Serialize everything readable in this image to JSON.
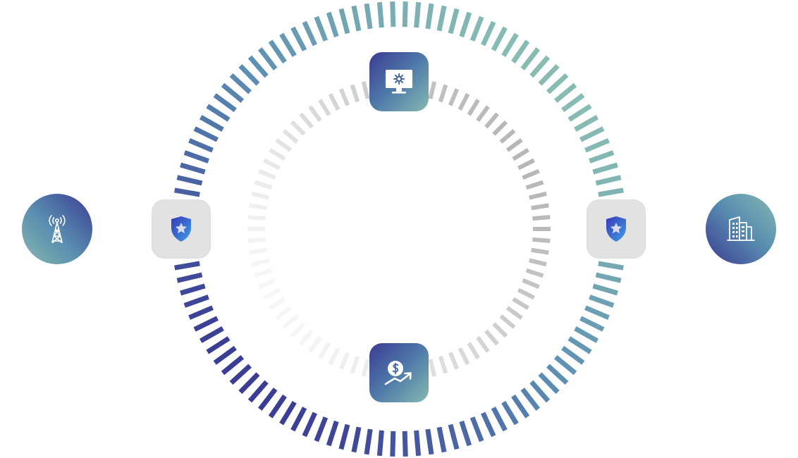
{
  "diagram": {
    "outer_ring": {
      "gradient": [
        "#88bcb3",
        "#5b8db3",
        "#3a3d93"
      ]
    },
    "inner_ring": {
      "gradient": [
        "#f6f6f6",
        "#b4b4b4"
      ]
    },
    "nodes": [
      {
        "id": "tower",
        "icon": "cell-tower-icon",
        "shape": "circle"
      },
      {
        "id": "shield-left",
        "icon": "shield-star-icon",
        "shape": "rounded-square"
      },
      {
        "id": "monitor",
        "icon": "monitor-gear-icon",
        "shape": "rounded-square"
      },
      {
        "id": "money",
        "icon": "dollar-growth-icon",
        "shape": "rounded-square"
      },
      {
        "id": "shield-right",
        "icon": "shield-star-icon",
        "shape": "rounded-square"
      },
      {
        "id": "building",
        "icon": "office-building-icon",
        "shape": "circle"
      }
    ],
    "colors": {
      "brand_dark": "#3b3b93",
      "brand_mid": "#4f7aa9",
      "brand_light": "#86b8b1",
      "shield_tile": "#e2e2e2"
    }
  }
}
